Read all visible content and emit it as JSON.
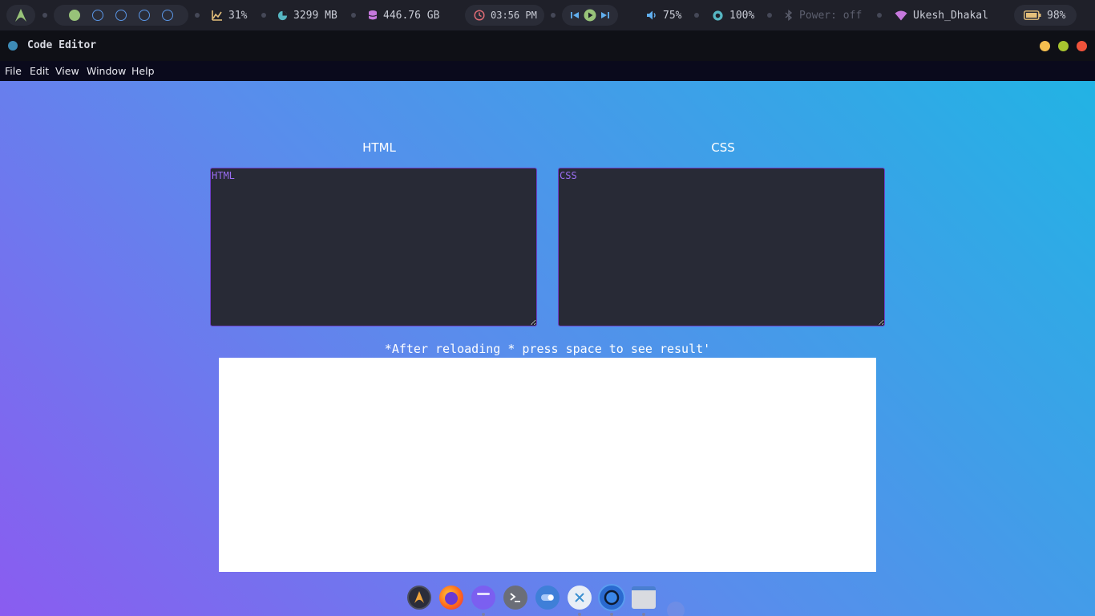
{
  "topbar": {
    "launcher_icon": "arch-icon",
    "workspaces": [
      "active",
      "empty",
      "empty",
      "empty",
      "empty"
    ],
    "cpu": "31%",
    "memory": "3299 MB",
    "disk": "446.76 GB",
    "clock": "03:56 PM",
    "volume": "75%",
    "brightness": "100%",
    "bluetooth": "Power: off",
    "wifi": "Ukesh_Dhakal",
    "battery": "98%"
  },
  "window": {
    "title": "Code Editor"
  },
  "menu": [
    "File",
    "Edit",
    "View",
    "Window",
    "Help"
  ],
  "editor": {
    "html_heading": "HTML",
    "css_heading": "CSS",
    "html_placeholder": "HTML",
    "css_placeholder": "CSS",
    "hint": "*After reloading * press space to see result'"
  },
  "colors": {
    "accent_purple": "#6d3fc8",
    "gradient_start": "#8a5cf0",
    "gradient_end": "#22b3e4",
    "editor_bg": "#282a36"
  },
  "dock": [
    {
      "name": "arch-launcher",
      "icon": "arch-icon"
    },
    {
      "name": "firefox",
      "icon": "firefox-icon"
    },
    {
      "name": "files",
      "icon": "folder-icon"
    },
    {
      "name": "terminal",
      "icon": "terminal-icon"
    },
    {
      "name": "settings",
      "icon": "toggle-icon"
    },
    {
      "name": "vscodium",
      "icon": "editor-icon"
    },
    {
      "name": "browser",
      "icon": "chromium-icon"
    },
    {
      "name": "window",
      "icon": "window-icon"
    }
  ]
}
